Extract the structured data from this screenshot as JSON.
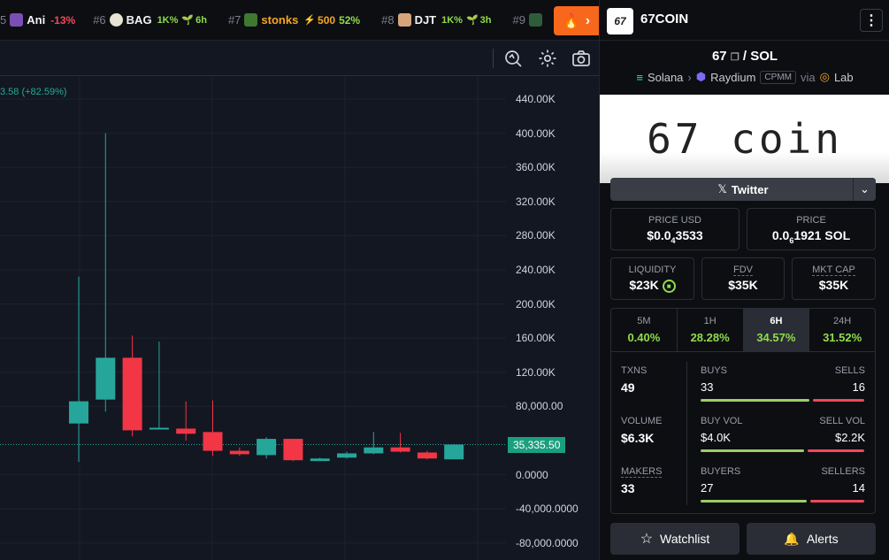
{
  "ticker": [
    {
      "rank": "5",
      "symbol": "Ani",
      "change": "-13%"
    },
    {
      "rank": "#6",
      "symbol": "BAG",
      "stat": "1K%",
      "age": "6h"
    },
    {
      "rank": "#7",
      "symbol": "stonks",
      "boost": "500",
      "change": "52%"
    },
    {
      "rank": "#8",
      "symbol": "DJT",
      "stat": "1K%",
      "age": "3h"
    },
    {
      "rank": "#9"
    }
  ],
  "chart": {
    "legend": "3.58 (+82.59%)",
    "current_price_label": "35,335.50",
    "axis_labels": [
      "440.00K",
      "400.00K",
      "360.00K",
      "320.00K",
      "280.00K",
      "240.00K",
      "200.00K",
      "160.00K",
      "120.00K",
      "80,000.00",
      "0.0000",
      "-40,000.0000",
      "-80,000.0000"
    ],
    "colors": {
      "up": "#26a69a",
      "down": "#f23645"
    }
  },
  "chart_data": {
    "type": "candlestick",
    "y_ticks": [
      440000,
      400000,
      360000,
      320000,
      280000,
      240000,
      200000,
      160000,
      120000,
      80000,
      0,
      -40000,
      -80000
    ],
    "current_price": 35335.5,
    "candles": [
      {
        "open": 60000,
        "close": 86000,
        "high": 232000,
        "low": 15000
      },
      {
        "open": 88000,
        "close": 137000,
        "high": 400000,
        "low": 74000
      },
      {
        "open": 137000,
        "close": 52000,
        "high": 163000,
        "low": 45000
      },
      {
        "open": 55000,
        "close": 55000,
        "high": 156000,
        "low": 53000
      },
      {
        "open": 54000,
        "close": 48000,
        "high": 86000,
        "low": 40000
      },
      {
        "open": 50000,
        "close": 28000,
        "high": 87000,
        "low": 22000
      },
      {
        "open": 28000,
        "close": 24000,
        "high": 32000,
        "low": 22000
      },
      {
        "open": 23000,
        "close": 42000,
        "high": 44000,
        "low": 19000
      },
      {
        "open": 42000,
        "close": 17000,
        "high": 42000,
        "low": 16000
      },
      {
        "open": 16000,
        "close": 19000,
        "high": 20000,
        "low": 16000
      },
      {
        "open": 20000,
        "close": 25000,
        "high": 27000,
        "low": 19000
      },
      {
        "open": 25000,
        "close": 32000,
        "high": 50000,
        "low": 24000
      },
      {
        "open": 32000,
        "close": 27000,
        "high": 49000,
        "low": 26000
      },
      {
        "open": 26000,
        "close": 19000,
        "high": 28000,
        "low": 18000
      },
      {
        "open": 18000,
        "close": 35335.5,
        "high": 36000,
        "low": 18000
      }
    ]
  },
  "panel": {
    "coin_name": "67COIN",
    "logo_text": "67",
    "pair_base": "67",
    "pair_quote": "SOL",
    "pair_sep": "/",
    "chain": "Solana",
    "dex": "Raydium",
    "pool_type": "CPMM",
    "via": "via",
    "launchpad": "Lab",
    "banner_text": "67 coin",
    "twitter_label": "Twitter",
    "price_usd_label": "PRICE USD",
    "price_usd_prefix": "$0.0",
    "price_usd_sub": "4",
    "price_usd_rest": "3533",
    "price_label": "PRICE",
    "price_prefix": "0.0",
    "price_sub": "6",
    "price_rest": "1921 SOL",
    "liquidity_label": "LIQUIDITY",
    "liquidity_value": "$23K",
    "fdv_label": "FDV",
    "fdv_value": "$35K",
    "mktcap_label": "MKT CAP",
    "mktcap_value": "$35K",
    "tabs": [
      {
        "label": "5M",
        "value": "0.40%"
      },
      {
        "label": "1H",
        "value": "28.28%"
      },
      {
        "label": "6H",
        "value": "34.57%"
      },
      {
        "label": "24H",
        "value": "31.52%"
      }
    ],
    "txns_label": "TXNS",
    "txns_value": "49",
    "buys_label": "BUYS",
    "buys_value": "33",
    "sells_label": "SELLS",
    "sells_value": "16",
    "volume_label": "VOLUME",
    "volume_value": "$6.3K",
    "buyvol_label": "BUY VOL",
    "buyvol_value": "$4.0K",
    "sellvol_label": "SELL VOL",
    "sellvol_value": "$2.2K",
    "makers_label": "MAKERS",
    "makers_value": "33",
    "buyers_label": "BUYERS",
    "buyers_value": "27",
    "sellers_label": "SELLERS",
    "sellers_value": "14",
    "ratios": {
      "buys": 0.673,
      "buy_vol": 0.645,
      "buyers": 0.659
    },
    "watchlist_label": "Watchlist",
    "alerts_label": "Alerts",
    "colors": {
      "green": "#8fdc4a",
      "red": "#f0485b"
    }
  }
}
